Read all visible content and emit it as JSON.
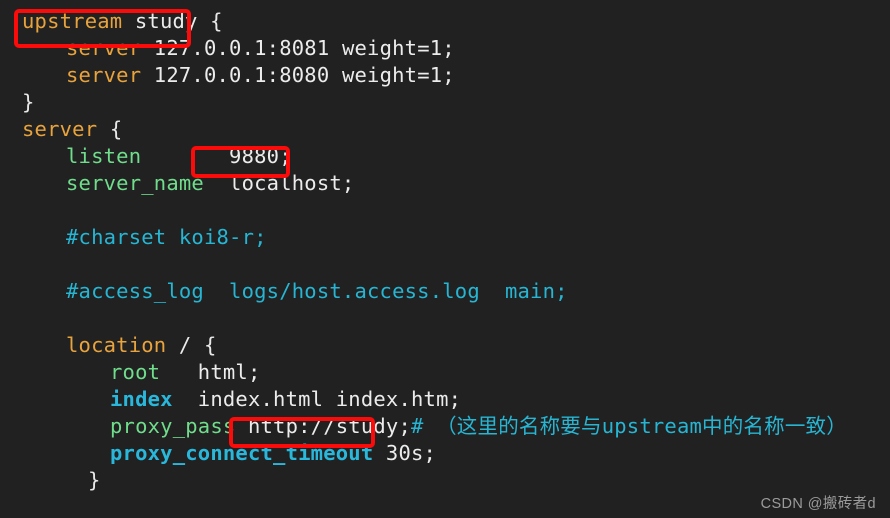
{
  "editor": {
    "background_color": "#212121",
    "default_text_color": "#ececec",
    "keyword_color": "#e8a33d",
    "green_directive_color": "#6fdd8b",
    "cyan_directive_color": "#29b8db",
    "comment_color": "#26b6d4",
    "annotation_color": "#fb0b09"
  },
  "code": {
    "lines": [
      {
        "n": 1,
        "indent": 0,
        "tokens": [
          {
            "t": "upstream",
            "c": "kw"
          },
          {
            "t": " study ",
            "c": "txt"
          },
          {
            "t": "{",
            "c": "punc"
          }
        ]
      },
      {
        "n": 2,
        "indent": 1,
        "tokens": [
          {
            "t": "server",
            "c": "kw"
          },
          {
            "t": " 127.0.0.1:8081 weight=1;",
            "c": "txt"
          }
        ]
      },
      {
        "n": 3,
        "indent": 1,
        "tokens": [
          {
            "t": "server",
            "c": "kw"
          },
          {
            "t": " 127.0.0.1:8080 weight=1;",
            "c": "txt"
          }
        ]
      },
      {
        "n": 4,
        "indent": 0,
        "tokens": [
          {
            "t": "}",
            "c": "punc"
          }
        ]
      },
      {
        "n": 5,
        "indent": 0,
        "tokens": [
          {
            "t": "server",
            "c": "kw"
          },
          {
            "t": " ",
            "c": "txt"
          },
          {
            "t": "{",
            "c": "punc"
          }
        ]
      },
      {
        "n": 6,
        "indent": 1,
        "tokens": [
          {
            "t": "listen",
            "c": "dir-g"
          },
          {
            "t": "       9880;",
            "c": "txt"
          }
        ]
      },
      {
        "n": 7,
        "indent": 1,
        "tokens": [
          {
            "t": "server_name",
            "c": "dir-g"
          },
          {
            "t": "  localhost;",
            "c": "txt"
          }
        ]
      },
      {
        "n": 8,
        "indent": 1,
        "tokens": []
      },
      {
        "n": 9,
        "indent": 1,
        "tokens": [
          {
            "t": "#charset koi8-r;",
            "c": "cmt"
          }
        ]
      },
      {
        "n": 10,
        "indent": 1,
        "tokens": []
      },
      {
        "n": 11,
        "indent": 1,
        "tokens": [
          {
            "t": "#access_log  logs/host.access.log  main;",
            "c": "cmt"
          }
        ]
      },
      {
        "n": 12,
        "indent": 1,
        "tokens": []
      },
      {
        "n": 13,
        "indent": 1,
        "tokens": [
          {
            "t": "location",
            "c": "kw"
          },
          {
            "t": " / ",
            "c": "txt"
          },
          {
            "t": "{",
            "c": "punc"
          }
        ]
      },
      {
        "n": 14,
        "indent": 2,
        "tokens": [
          {
            "t": "root",
            "c": "dir-g"
          },
          {
            "t": "   html;",
            "c": "txt"
          }
        ]
      },
      {
        "n": 15,
        "indent": 2,
        "tokens": [
          {
            "t": "index",
            "c": "dir-b"
          },
          {
            "t": "  index.html index.htm;",
            "c": "txt"
          }
        ]
      },
      {
        "n": 16,
        "indent": 2,
        "tokens": [
          {
            "t": "proxy_pass",
            "c": "dir-g"
          },
          {
            "t": " http://study;",
            "c": "txt"
          },
          {
            "t": "# （这里的名称要与upstream中的名称一致）",
            "c": "cmt"
          }
        ]
      },
      {
        "n": 17,
        "indent": 2,
        "tokens": [
          {
            "t": "proxy_connect_timeout",
            "c": "dir-b"
          },
          {
            "t": " 30s;",
            "c": "txt"
          }
        ]
      },
      {
        "n": 18,
        "indent": 3,
        "tokens": [
          {
            "t": "}",
            "c": "punc"
          }
        ]
      }
    ]
  },
  "annotations": [
    {
      "id": "box-upstream",
      "label": "upstream study",
      "target": "upstream-block-name"
    },
    {
      "id": "box-port",
      "label": "9880;",
      "target": "listen-port-value"
    },
    {
      "id": "box-proxy",
      "label": "http://study;",
      "target": "proxy-pass-url"
    }
  ],
  "watermark": {
    "text": "CSDN @搬砖者d"
  }
}
